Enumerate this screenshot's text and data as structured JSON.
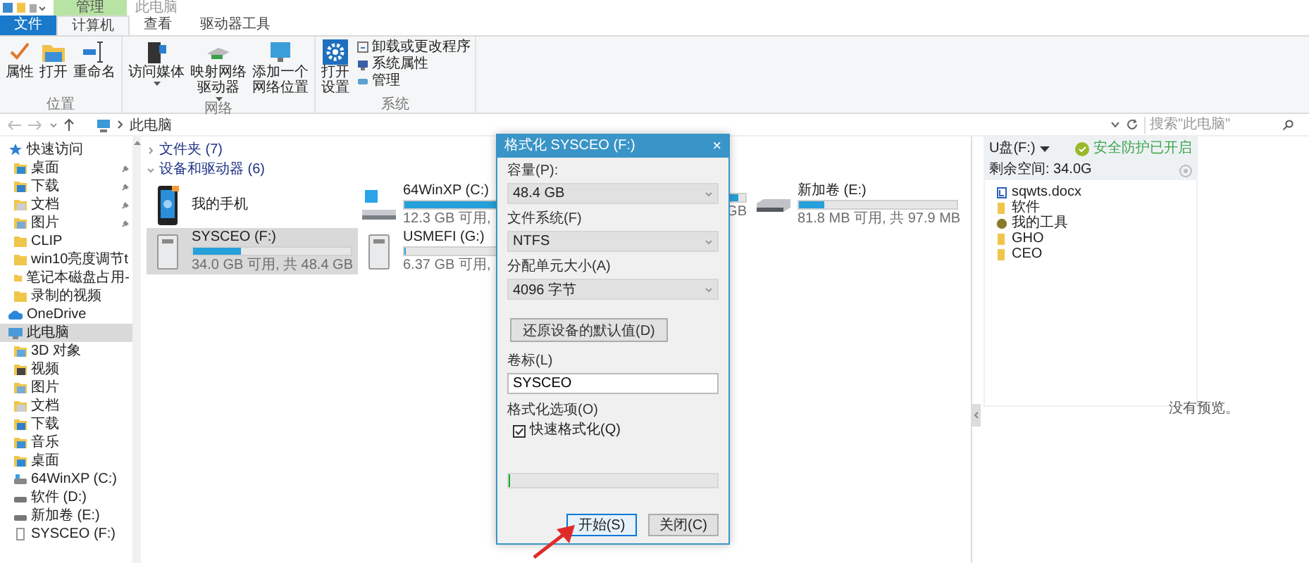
{
  "title_bar": {
    "context_tab": "管理",
    "title": "此电脑"
  },
  "ribbon_tabs": [
    {
      "label": "文件",
      "kind": "file",
      "selected": false
    },
    {
      "label": "计算机",
      "kind": "tab",
      "selected": true
    },
    {
      "label": "查看",
      "kind": "tab",
      "selected": false
    },
    {
      "label": "驱动器工具",
      "kind": "tab",
      "selected": false
    }
  ],
  "ribbon_groups": [
    {
      "label": "位置",
      "buttons": [
        {
          "kind": "check",
          "lines": [
            "属性"
          ],
          "dropdown": false
        },
        {
          "kind": "folder",
          "lines": [
            "打开"
          ],
          "dropdown": false
        },
        {
          "kind": "rename",
          "lines": [
            "重命名"
          ],
          "dropdown": false
        }
      ]
    },
    {
      "label": "网络",
      "buttons": [
        {
          "kind": "media",
          "lines": [
            "访问媒体"
          ],
          "dropdown": true
        },
        {
          "kind": "netdrive",
          "lines": [
            "映射网络",
            "驱动器"
          ],
          "dropdown": true
        },
        {
          "kind": "network",
          "lines": [
            "添加一个",
            "网络位置"
          ],
          "dropdown": false
        }
      ]
    },
    {
      "label": "系统",
      "buttons": [
        {
          "kind": "gear",
          "lines": [
            "打开",
            "设置"
          ],
          "dropdown": false
        }
      ],
      "small_buttons": [
        {
          "kind": "uninstall",
          "label": "卸载或更改程序"
        },
        {
          "kind": "properties",
          "label": "系统属性"
        },
        {
          "kind": "manage",
          "label": "管理"
        }
      ]
    }
  ],
  "address": {
    "path": "此电脑"
  },
  "search": {
    "placeholder": "搜索\"此电脑\""
  },
  "nav": [
    {
      "label": "快速访问",
      "kind": "star",
      "selected": false,
      "children": [
        {
          "label": "桌面",
          "kind": "desktop",
          "pinned": true,
          "selected": false
        },
        {
          "label": "下载",
          "kind": "download",
          "pinned": true,
          "selected": false
        },
        {
          "label": "文档",
          "kind": "doc",
          "pinned": true,
          "selected": false
        },
        {
          "label": "图片",
          "kind": "picture",
          "pinned": true,
          "selected": false
        },
        {
          "label": "CLIP",
          "kind": "folder",
          "pinned": false,
          "selected": false
        },
        {
          "label": "win10亮度调节t",
          "kind": "folder",
          "pinned": false,
          "selected": false
        },
        {
          "label": "笔记本磁盘占用-",
          "kind": "folder",
          "pinned": false,
          "selected": false
        },
        {
          "label": "录制的视频",
          "kind": "folder",
          "pinned": false,
          "selected": false
        }
      ]
    },
    {
      "label": "OneDrive",
      "kind": "cloud",
      "selected": false
    },
    {
      "label": "此电脑",
      "kind": "pc",
      "selected": true,
      "children": [
        {
          "label": "3D 对象",
          "kind": "cube",
          "pinned": false,
          "selected": false
        },
        {
          "label": "视频",
          "kind": "video",
          "pinned": false,
          "selected": false
        },
        {
          "label": "图片",
          "kind": "picture",
          "pinned": false,
          "selected": false
        },
        {
          "label": "文档",
          "kind": "doc",
          "pinned": false,
          "selected": false
        },
        {
          "label": "下载",
          "kind": "download",
          "pinned": false,
          "selected": false
        },
        {
          "label": "音乐",
          "kind": "music",
          "pinned": false,
          "selected": false
        },
        {
          "label": "桌面",
          "kind": "desktop",
          "pinned": false,
          "selected": false
        },
        {
          "label": "64WinXP  (C:)",
          "kind": "windrive",
          "pinned": false,
          "selected": false
        },
        {
          "label": "软件 (D:)",
          "kind": "drive",
          "pinned": false,
          "selected": false
        },
        {
          "label": "新加卷 (E:)",
          "kind": "drive",
          "pinned": false,
          "selected": false
        },
        {
          "label": "SYSCEO (F:)",
          "kind": "usb",
          "pinned": false,
          "selected": false
        }
      ]
    }
  ],
  "sections": [
    {
      "label": "文件夹 (7)",
      "expanded": false
    },
    {
      "label": "设备和驱动器 (6)",
      "expanded": true,
      "drives": [
        {
          "kind": "phone",
          "name": "我的手机",
          "selected": false
        },
        {
          "kind": "windrive",
          "name": "64WinXP  (C:)",
          "level": 0.88,
          "usage": "12.3 GB 可用,",
          "selected": false
        },
        {
          "level": 0.95,
          "usage": "GB",
          "selected": false,
          "covered": true
        },
        {
          "kind": "drive",
          "name": "新加卷 (E:)",
          "level": 0.16,
          "usage": "81.8 MB 可用, 共 97.9 MB",
          "selected": false
        },
        {
          "kind": "usb",
          "name": "SYSCEO (F:)",
          "level": 0.3,
          "usage": "34.0 GB 可用, 共 48.4 GB",
          "selected": true
        },
        {
          "kind": "usb",
          "name": "USMEFI (G:)",
          "level": 0.0,
          "usage": "6.37 GB 可用,",
          "selected": false
        }
      ]
    }
  ],
  "preview": {
    "drive_label": "U盘(F:)",
    "status": "安全防护已开启",
    "free_space": "剩余空间: 34.0G",
    "files": [
      {
        "name": "sqwts.docx",
        "kind": "word"
      },
      {
        "name": "软件",
        "kind": "folder"
      },
      {
        "name": "我的工具",
        "kind": "tool"
      },
      {
        "name": "GHO",
        "kind": "folder"
      },
      {
        "name": "CEO",
        "kind": "folder"
      }
    ],
    "empty_message": "没有预览。"
  },
  "dialog": {
    "title": "格式化 SYSCEO (F:)",
    "close": "×",
    "fields": [
      {
        "label": "容量(P):",
        "value": "48.4 GB"
      },
      {
        "label": "文件系统(F)",
        "value": "NTFS"
      },
      {
        "label": "分配单元大小(A)",
        "value": "4096 字节"
      }
    ],
    "restore_button": "还原设备的默认值(D)",
    "volume_label": {
      "label": "卷标(L)",
      "value": "SYSCEO"
    },
    "options_label": "格式化选项(O)",
    "quick_format": {
      "label": "快速格式化(Q)",
      "checked": true
    },
    "progress": {
      "level": 0
    },
    "buttons": [
      {
        "label": "开始(S)",
        "focused": true
      },
      {
        "label": "关闭(C)",
        "focused": false
      }
    ]
  },
  "annotation": {
    "kind": "arrow"
  }
}
